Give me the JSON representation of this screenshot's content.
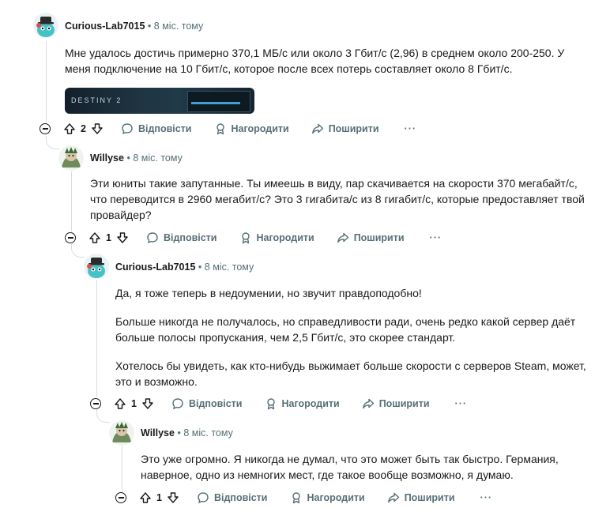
{
  "comments": [
    {
      "author": "Curious-Lab7015",
      "time": "8 міс. тому",
      "paragraphs": [
        "Мне удалось достичь примерно 370,1 МБ/с или около 3 Гбит/с (2,96) в среднем около 200-250. У меня подключение на 10 Гбит/с, которое после всех потерь составляет около 8 Гбит/с."
      ],
      "votes": "2",
      "image_caption": "DESTINY 2"
    },
    {
      "author": "Willyse",
      "time": "8 міс. тому",
      "paragraphs": [
        "Эти юниты такие запутанные. Ты имеешь в виду, пар скачивается на скорости 370 мегабайт/с, что переводится в 2960 мегабит/с? Это 3 гигабита/с из 8 гигабит/с, которые предоставляет твой провайдер?"
      ],
      "votes": "1"
    },
    {
      "author": "Curious-Lab7015",
      "time": "8 міс. тому",
      "paragraphs": [
        "Да, я тоже теперь в недоумении, но звучит правдоподобно!",
        "Больше никогда не получалось, но справедливости ради, очень редко какой сервер даёт больше полосы пропускания, чем 2,5 Гбит/с, это скорее стандарт.",
        "Хотелось бы увидеть, как кто-нибудь выжимает больше скорости с серверов Steam, может, это и возможно."
      ],
      "votes": "1"
    },
    {
      "author": "Willyse",
      "time": "8 міс. тому",
      "paragraphs": [
        "Это уже огромно. Я никогда не думал, что это может быть так быстро. Германия, наверное, одно из немногих мест, где такое вообще возможно, я думаю."
      ],
      "votes": "1"
    }
  ],
  "actions": {
    "reply": "Відповісти",
    "award": "Нагородити",
    "share": "Поширити",
    "more": "···"
  },
  "separator": "•"
}
